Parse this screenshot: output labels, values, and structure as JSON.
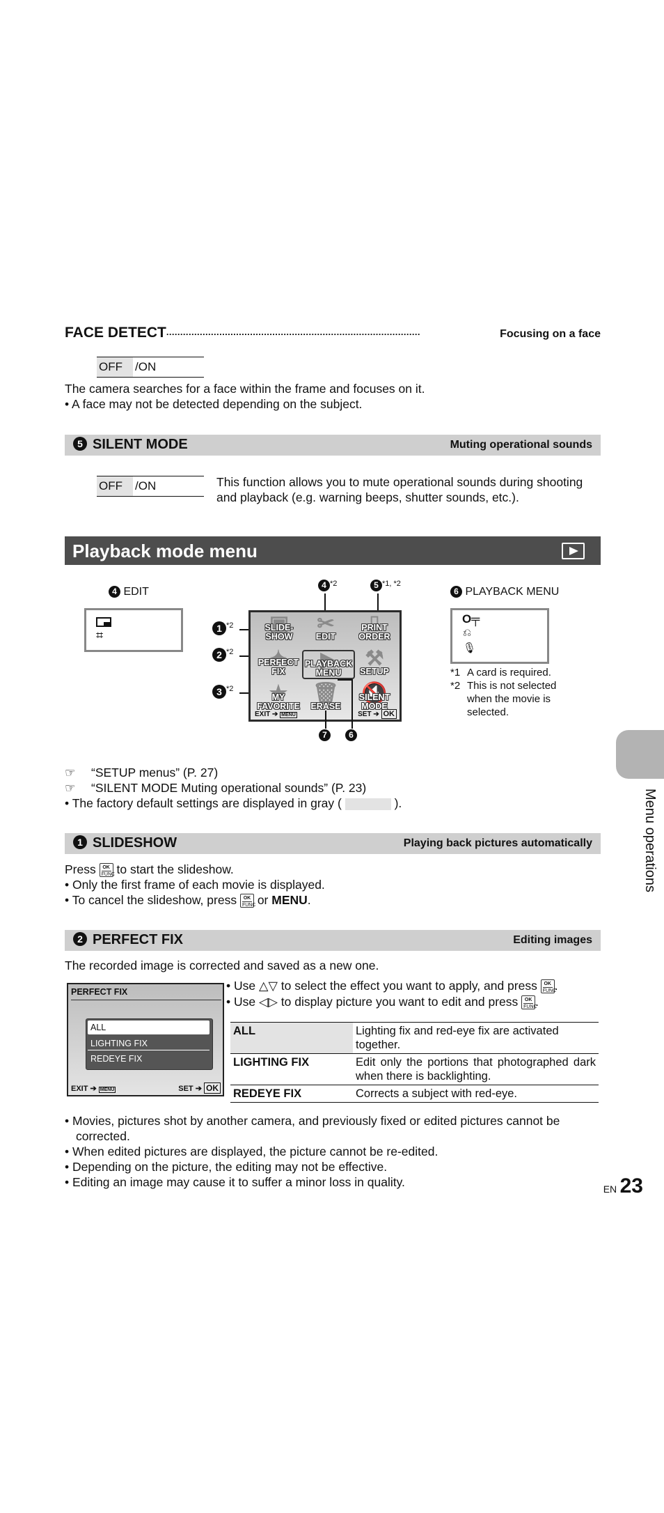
{
  "face_detect": {
    "title": "FACE DETECT",
    "leader": "...........................................................................................",
    "subtitle": "Focusing on a face",
    "option_default": "OFF",
    "option_other": "/ON",
    "description": "The camera searches for a face within the frame and focuses on it.",
    "bullets": [
      "A face may not be detected depending on the subject."
    ]
  },
  "silent_mode": {
    "number": "5",
    "title": "SILENT MODE",
    "subtitle": "Muting operational sounds",
    "option_default": "OFF",
    "option_other": "/ON",
    "description": "This function allows you to mute operational sounds during shooting and playback (e.g. warning beeps, shutter sounds, etc.)."
  },
  "playback_header": {
    "title": "Playback mode menu",
    "icon": "playback-icon"
  },
  "diagram": {
    "edit_callout": {
      "number": "4",
      "label": "EDIT",
      "icons": [
        "resize-icon",
        "crop-icon"
      ]
    },
    "playback_callout": {
      "number": "6",
      "label": "PLAYBACK MENU",
      "icons": [
        "protect-key-icon",
        "rotate-icon",
        "microphone-icon"
      ]
    },
    "callouts": [
      {
        "number": "1",
        "note": "*2"
      },
      {
        "number": "2",
        "note": "*2"
      },
      {
        "number": "3",
        "note": "*2"
      },
      {
        "number": "4",
        "note": "*2"
      },
      {
        "number": "5",
        "note": "*1, *2"
      },
      {
        "number": "7",
        "note": ""
      },
      {
        "number": "6",
        "note": ""
      }
    ],
    "menu_items": [
      {
        "line1": "SLIDE-",
        "line2": "SHOW",
        "icon": "▣"
      },
      {
        "line1": "",
        "line2": "EDIT",
        "icon": "✂"
      },
      {
        "line1": "PRINT",
        "line2": "ORDER",
        "icon": "⎍"
      },
      {
        "line1": "PERFECT",
        "line2": "FIX",
        "icon": "✦"
      },
      {
        "line1": "PLAYBACK",
        "line2": "MENU",
        "icon": "▶"
      },
      {
        "line1": "",
        "line2": "SETUP",
        "icon": "⚒"
      },
      {
        "line1": "MY",
        "line2": "FAVORITE",
        "icon": "★"
      },
      {
        "line1": "",
        "line2": "ERASE",
        "icon": "🗑"
      },
      {
        "line1": "SILENT",
        "line2": "MODE",
        "icon": "🔇"
      }
    ],
    "exit_label": "EXIT",
    "exit_key": "MENU",
    "set_label": "SET",
    "set_key": "OK",
    "footnotes": [
      {
        "mark": "*1",
        "text": "A card is required."
      },
      {
        "mark": "*2",
        "text": "This is not selected when the movie is selected."
      }
    ]
  },
  "references": [
    {
      "text": "“SETUP menus” (P. 27)"
    },
    {
      "text": "“SILENT MODE Muting operational sounds” (P. 23)"
    }
  ],
  "default_note_before": "The factory default settings are displayed in gray (",
  "default_note_after": ").",
  "slideshow": {
    "number": "1",
    "title": "SLIDESHOW",
    "subtitle": "Playing back pictures automatically",
    "press": "Press",
    "press_after": "to start the slideshow.",
    "bullet1": "Only the first frame of each movie is displayed.",
    "bullet2_before": "To cancel the slideshow, press",
    "bullet2_or": "or",
    "bullet2_menu": "MENU",
    "bullet2_end": "."
  },
  "perfect_fix": {
    "number": "2",
    "title": "PERFECT FIX",
    "subtitle": "Editing images",
    "description": "The recorded image is corrected and saved as a new one.",
    "screen_title": "PERFECT FIX",
    "screen_options": [
      "ALL",
      "LIGHTING FIX",
      "REDEYE FIX"
    ],
    "screen_exit": "EXIT",
    "screen_exit_key": "MENU",
    "screen_set": "SET",
    "screen_set_key": "OK",
    "instr1_before": "Use",
    "instr1_arrows": "△▽",
    "instr1_after": "to select the effect you want to apply, and press",
    "instr2_before": "Use",
    "instr2_arrows": "◁▷",
    "instr2_after": "to display picture you want to edit and press",
    "table": [
      {
        "option": "ALL",
        "desc": "Lighting fix and red-eye fix are activated together.",
        "default": true
      },
      {
        "option": "LIGHTING FIX",
        "desc": "Edit only the portions that photographed dark when there is backlighting.",
        "default": false
      },
      {
        "option": "REDEYE FIX",
        "desc": "Corrects a subject with red-eye.",
        "default": false
      }
    ],
    "notes": [
      "Movies, pictures shot by another camera, and previously fixed or edited pictures cannot be corrected.",
      "When edited pictures are displayed, the picture cannot be re-edited.",
      "Depending on the picture, the editing may not be effective.",
      "Editing an image may cause it to suffer a minor loss in quality."
    ]
  },
  "ok_key": {
    "top": "OK",
    "bottom": "FUNC"
  },
  "side_tab": {
    "label": "Menu operations"
  },
  "page": {
    "lang": "EN",
    "number": "23"
  },
  "colors": {
    "section_bar": "#cfcfcf",
    "header_bar": "#4d4d4d",
    "default_gray": "#e3e3e3",
    "side_tab": "#b3b3b3"
  }
}
